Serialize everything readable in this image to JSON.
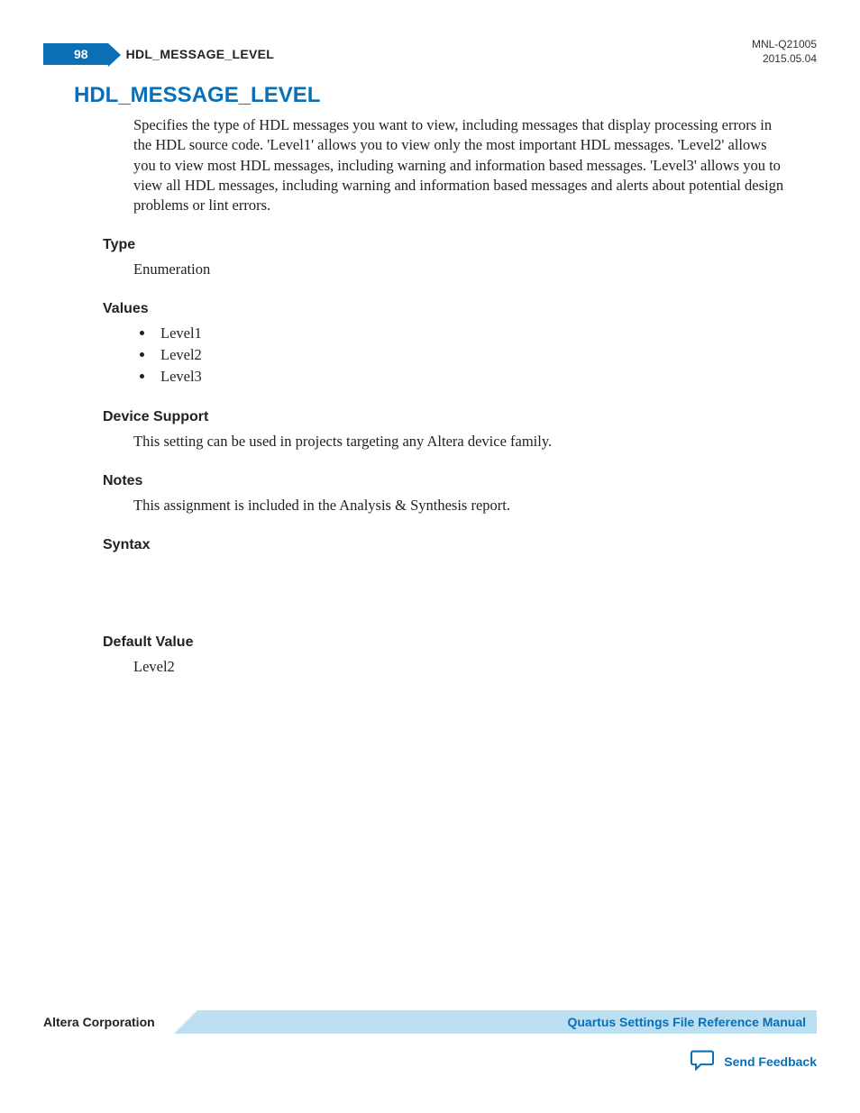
{
  "header": {
    "doc_id": "MNL-Q21005",
    "date": "2015.05.04",
    "page_number": "98",
    "running_title": "HDL_MESSAGE_LEVEL"
  },
  "title": "HDL_MESSAGE_LEVEL",
  "description": "Specifies the type of HDL messages you want to view, including messages that display processing errors in the HDL source code. 'Level1' allows you to view only the most important HDL messages. 'Level2' allows you to view most HDL messages, including warning and information based messages. 'Level3' allows you to view all HDL messages, including warning and information based messages and alerts about potential design problems or lint errors.",
  "sections": {
    "type": {
      "heading": "Type",
      "text": "Enumeration"
    },
    "values": {
      "heading": "Values",
      "items": [
        "Level1",
        "Level2",
        "Level3"
      ]
    },
    "device_support": {
      "heading": "Device Support",
      "text": "This setting can be used in projects targeting any Altera device family."
    },
    "notes": {
      "heading": "Notes",
      "text": "This assignment is included in the Analysis & Synthesis report."
    },
    "syntax": {
      "heading": "Syntax"
    },
    "default_value": {
      "heading": "Default Value",
      "text": "Level2"
    }
  },
  "footer": {
    "company": "Altera Corporation",
    "manual": "Quartus Settings File Reference Manual",
    "feedback": "Send Feedback"
  }
}
